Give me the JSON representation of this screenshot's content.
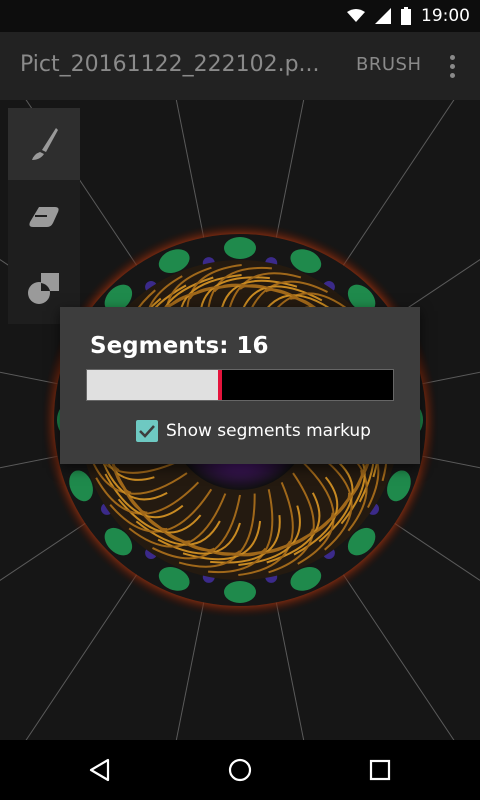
{
  "status_bar": {
    "time": "19:00",
    "icons": [
      "wifi-icon",
      "signal-icon",
      "battery-icon"
    ]
  },
  "app_bar": {
    "title": "Pict_20161122_222102.p...",
    "action_label": "BRUSH",
    "overflow_icon": "more-vert-icon"
  },
  "tools": [
    {
      "name": "brush-tool",
      "icon": "brush-icon",
      "active": true
    },
    {
      "name": "eraser-tool",
      "icon": "eraser-icon",
      "active": false
    },
    {
      "name": "shapes-tool",
      "icon": "shapes-icon",
      "active": false
    }
  ],
  "dialog": {
    "segments_text": "Segments: 16",
    "segments_value": 16,
    "seek_fraction": 0.43,
    "show_markup_label": "Show segments markup",
    "show_markup_checked": true
  },
  "colors": {
    "accent_teal": "#6ec9c2",
    "seek_thumb": "#e4143c",
    "dialog_bg": "#3d3d3d",
    "appbar_bg": "#222222"
  },
  "nav_bar": {
    "icons": [
      "back-icon",
      "home-icon",
      "recents-icon"
    ]
  }
}
